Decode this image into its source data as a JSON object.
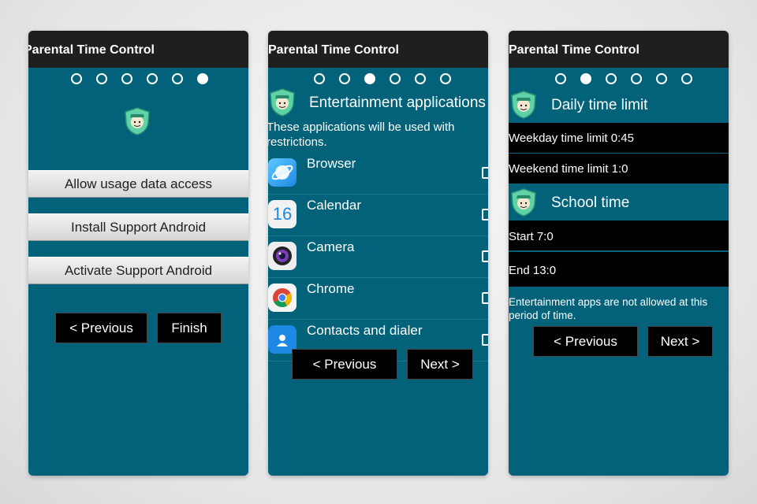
{
  "app_title": "Parental Time Control",
  "screen1": {
    "progress_step": 6,
    "progress_total": 6,
    "buttons": [
      "Allow usage data access",
      "Install Support Android",
      "Activate Support Android"
    ],
    "previous_label": "< Previous",
    "finish_label": "Finish"
  },
  "screen2": {
    "progress_step": 3,
    "progress_total": 6,
    "heading": "Entertainment applications",
    "description": "These applications will be used with restrictions.",
    "apps": [
      {
        "label": "Browser",
        "icon": "browser-icon",
        "checked": false
      },
      {
        "label": "Calendar",
        "icon": "calendar-icon",
        "icon_text": "16",
        "checked": false
      },
      {
        "label": "Camera",
        "icon": "camera-icon",
        "checked": false
      },
      {
        "label": "Chrome",
        "icon": "chrome-icon",
        "checked": false
      },
      {
        "label": "Contacts and dialer",
        "icon": "contacts-icon",
        "checked": false
      }
    ],
    "previous_label": "< Previous",
    "next_label": "Next >"
  },
  "screen3": {
    "progress_step": 2,
    "progress_total": 6,
    "daily_heading": "Daily time limit",
    "weekday_limit": "Weekday time limit 0:45",
    "weekend_limit": "Weekend time limit 1:0",
    "school_heading": "School time",
    "start": "Start 7:0",
    "end": "End 13:0",
    "note": "Entertainment apps are not allowed at this period of time.",
    "previous_label": "< Previous",
    "next_label": "Next >"
  },
  "colors": {
    "screen_bg": "#02627a",
    "titlebar_bg": "#1f1f1f",
    "shield_green": "#5fd3a8"
  }
}
